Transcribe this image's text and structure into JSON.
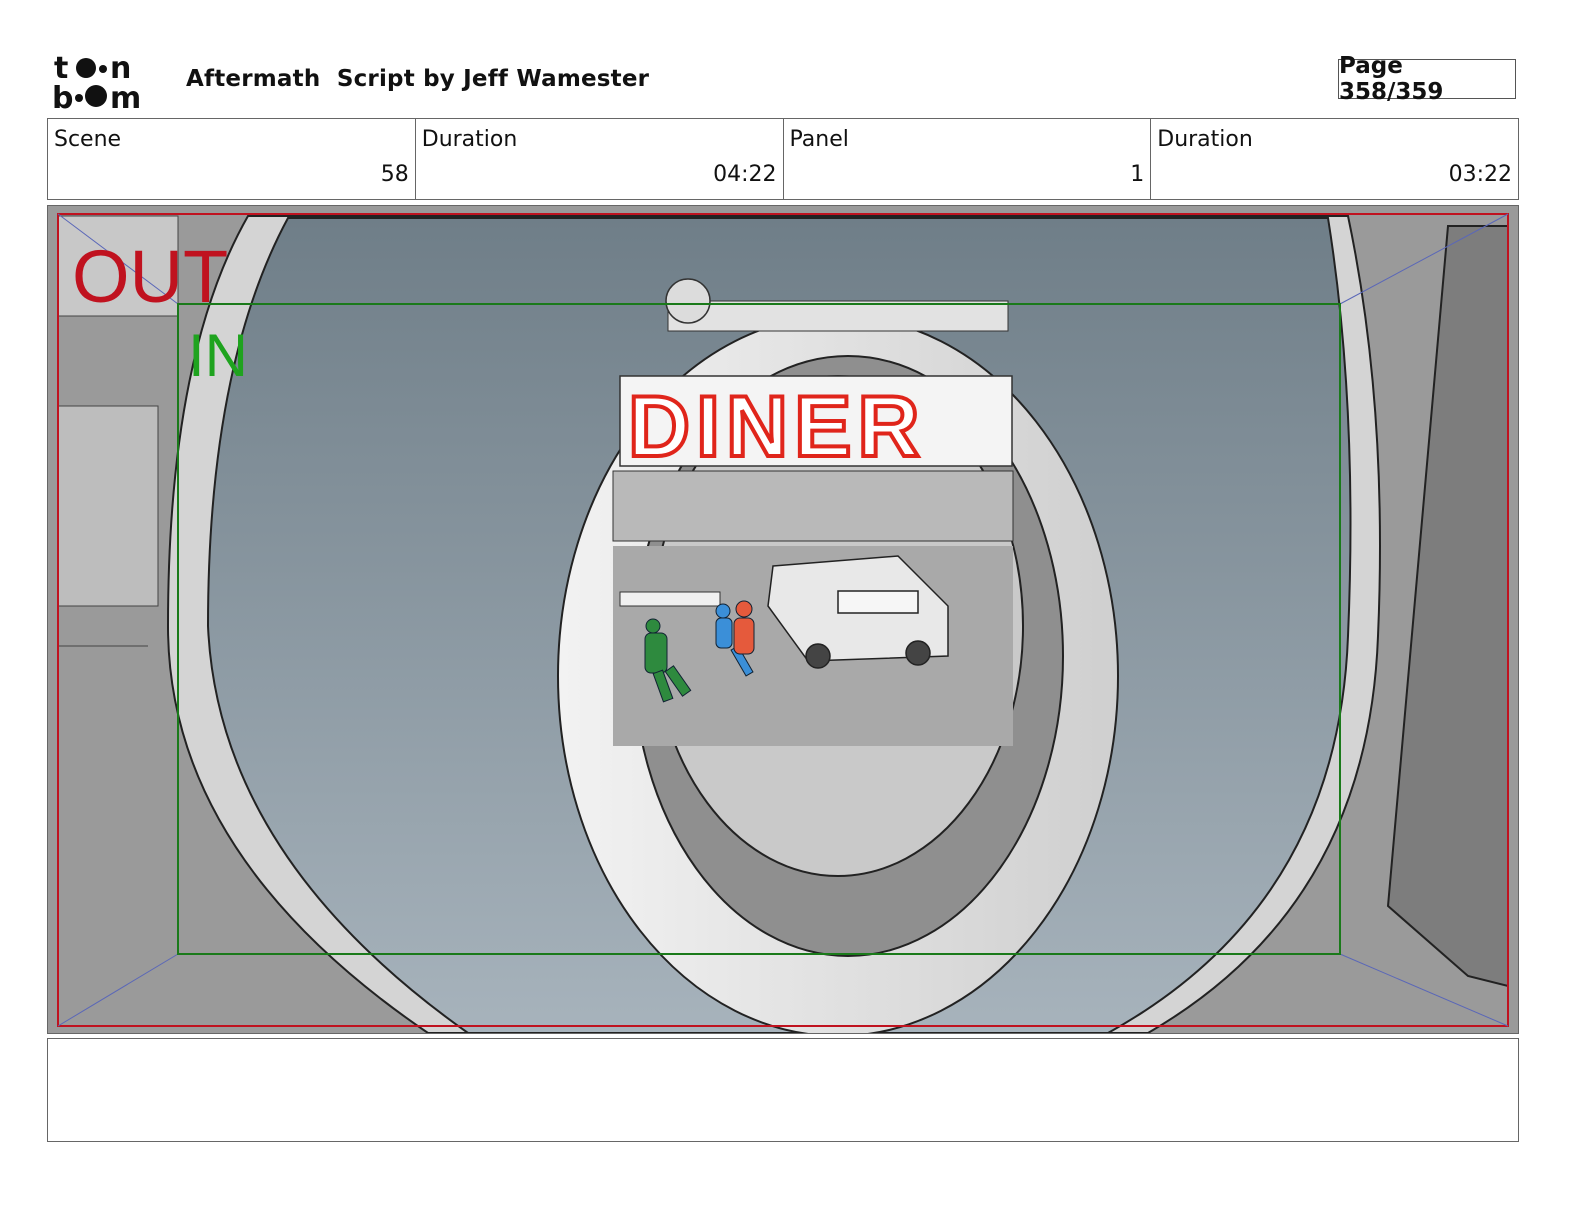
{
  "header": {
    "logo_text": "toon boom",
    "title": "Aftermath  Script by Jeff Wamester",
    "page": "Page 358/359"
  },
  "info": {
    "scene_label": "Scene",
    "scene_value": "58",
    "duration_label": "Duration",
    "duration_value": "04:22",
    "panel_label": "Panel",
    "panel_value": "1",
    "panel_duration_label": "Duration",
    "panel_duration_value": "03:22"
  },
  "panel": {
    "out_label": "OUT",
    "in_label": "IN",
    "sign_text": "DINER",
    "colors": {
      "out_frame": "#c0121f",
      "in_frame": "#1a7a1a",
      "sign": "#e0251b"
    }
  },
  "notes": {
    "text": ""
  }
}
